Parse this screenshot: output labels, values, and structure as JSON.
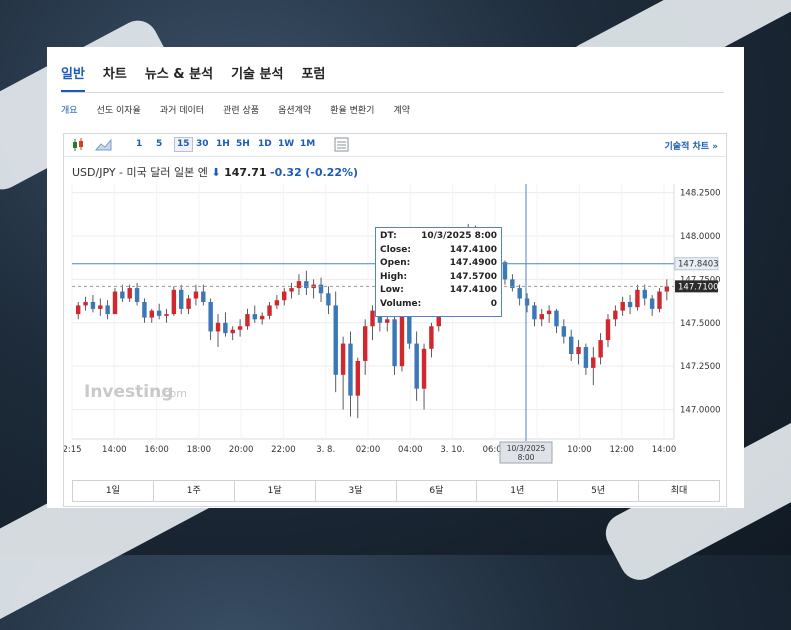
{
  "main_tabs": [
    "일반",
    "차트",
    "뉴스 & 분석",
    "기술 분석",
    "포럼"
  ],
  "sub_tabs": [
    "개요",
    "선도 이자율",
    "과거 데이터",
    "관련 상품",
    "옵션계약",
    "환율 변환기",
    "계약"
  ],
  "toolbar": {
    "intervals": [
      "1",
      "5",
      "15",
      "30",
      "1H",
      "5H",
      "1D",
      "1W",
      "1M"
    ],
    "selected_interval": "15",
    "technical_chart_link": "기술적 차트 »"
  },
  "quote": {
    "name": "USD/JPY - 미국 달러 일본 엔",
    "arrow": "⬇",
    "price": "147.71",
    "change": "-0.32",
    "change_pct": "(-0.22%)"
  },
  "watermark": "Investing",
  "watermark_suffix": ".com",
  "tooltip": {
    "rows": [
      {
        "k": "DT:",
        "v": "10/3/2025 8:00"
      },
      {
        "k": "Close:",
        "v": "147.4100"
      },
      {
        "k": "Open:",
        "v": "147.4900"
      },
      {
        "k": "High:",
        "v": "147.5700"
      },
      {
        "k": "Low:",
        "v": "147.4100"
      },
      {
        "k": "Volume:",
        "v": "0"
      }
    ]
  },
  "range_buttons": [
    "1일",
    "1주",
    "1달",
    "3달",
    "6달",
    "1년",
    "5년",
    "최대"
  ],
  "colors": {
    "up": "#d0282e",
    "down": "#3b78b8",
    "accent": "#1a5bb8"
  },
  "chart_data": {
    "type": "candlestick",
    "y_ticks": [
      "148.2500",
      "148.0000",
      "147.7500",
      "147.5000",
      "147.2500",
      "147.0000"
    ],
    "ylim": [
      146.83,
      148.3
    ],
    "x_ticks": [
      "2:15",
      "14:00",
      "16:00",
      "18:00",
      "20:00",
      "22:00",
      "3. 8.",
      "02:00",
      "04:00",
      "3. 10.",
      "06:00",
      "08:00",
      "10:00",
      "12:00",
      "14:00"
    ],
    "crosshair_x_label": "10/3/2025\n8:00",
    "crosshair_y_label": "147.8403",
    "last_price_label": "147.7100",
    "candles_ohlc": [
      [
        147.55,
        147.62,
        147.52,
        147.6
      ],
      [
        147.6,
        147.65,
        147.57,
        147.62
      ],
      [
        147.62,
        147.66,
        147.56,
        147.58
      ],
      [
        147.58,
        147.64,
        147.54,
        147.6
      ],
      [
        147.6,
        147.63,
        147.52,
        147.55
      ],
      [
        147.55,
        147.7,
        147.55,
        147.68
      ],
      [
        147.68,
        147.72,
        147.62,
        147.64
      ],
      [
        147.64,
        147.72,
        147.62,
        147.7
      ],
      [
        147.7,
        147.73,
        147.6,
        147.62
      ],
      [
        147.62,
        147.64,
        147.5,
        147.53
      ],
      [
        147.53,
        147.58,
        147.5,
        147.57
      ],
      [
        147.57,
        147.61,
        147.52,
        147.54
      ],
      [
        147.54,
        147.58,
        147.5,
        147.55
      ],
      [
        147.55,
        147.71,
        147.54,
        147.69
      ],
      [
        147.69,
        147.72,
        147.55,
        147.58
      ],
      [
        147.58,
        147.66,
        147.55,
        147.64
      ],
      [
        147.64,
        147.72,
        147.6,
        147.68
      ],
      [
        147.68,
        147.72,
        147.6,
        147.62
      ],
      [
        147.62,
        147.64,
        147.4,
        147.45
      ],
      [
        147.45,
        147.55,
        147.36,
        147.5
      ],
      [
        147.5,
        147.56,
        147.42,
        147.44
      ],
      [
        147.44,
        147.48,
        147.4,
        147.46
      ],
      [
        147.46,
        147.52,
        147.42,
        147.48
      ],
      [
        147.48,
        147.58,
        147.46,
        147.55
      ],
      [
        147.55,
        147.6,
        147.5,
        147.52
      ],
      [
        147.52,
        147.56,
        147.49,
        147.54
      ],
      [
        147.54,
        147.62,
        147.52,
        147.6
      ],
      [
        147.6,
        147.66,
        147.58,
        147.63
      ],
      [
        147.63,
        147.7,
        147.6,
        147.68
      ],
      [
        147.68,
        147.73,
        147.64,
        147.7
      ],
      [
        147.7,
        147.78,
        147.66,
        147.74
      ],
      [
        147.74,
        147.8,
        147.66,
        147.7
      ],
      [
        147.7,
        147.75,
        147.64,
        147.72
      ],
      [
        147.72,
        147.76,
        147.62,
        147.67
      ],
      [
        147.67,
        147.71,
        147.55,
        147.6
      ],
      [
        147.6,
        147.68,
        147.1,
        147.2
      ],
      [
        147.2,
        147.42,
        147.0,
        147.38
      ],
      [
        147.38,
        147.45,
        146.96,
        147.08
      ],
      [
        147.08,
        147.3,
        146.95,
        147.28
      ],
      [
        147.28,
        147.52,
        147.2,
        147.48
      ],
      [
        147.48,
        147.6,
        147.4,
        147.57
      ],
      [
        147.57,
        147.65,
        147.45,
        147.5
      ],
      [
        147.5,
        147.7,
        147.45,
        147.52
      ],
      [
        147.52,
        147.55,
        147.2,
        147.25
      ],
      [
        147.25,
        147.58,
        147.22,
        147.55
      ],
      [
        147.55,
        147.6,
        147.35,
        147.38
      ],
      [
        147.38,
        147.45,
        147.05,
        147.12
      ],
      [
        147.12,
        147.38,
        147.0,
        147.35
      ],
      [
        147.35,
        147.5,
        147.3,
        147.48
      ],
      [
        147.48,
        147.62,
        147.45,
        147.6
      ],
      [
        147.6,
        147.7,
        147.55,
        147.65
      ],
      [
        147.65,
        147.8,
        147.62,
        147.76
      ],
      [
        147.76,
        148.05,
        147.7,
        148.02
      ],
      [
        148.02,
        148.07,
        147.98,
        148.03
      ],
      [
        148.03,
        148.06,
        147.96,
        147.98
      ],
      [
        147.98,
        148.0,
        147.9,
        147.94
      ],
      [
        147.94,
        147.97,
        147.86,
        147.9
      ],
      [
        147.9,
        147.92,
        147.82,
        147.85
      ],
      [
        147.85,
        147.86,
        147.72,
        147.75
      ],
      [
        147.75,
        147.78,
        147.68,
        147.7
      ],
      [
        147.7,
        147.72,
        147.6,
        147.64
      ],
      [
        147.64,
        147.67,
        147.56,
        147.6
      ],
      [
        147.6,
        147.62,
        147.48,
        147.52
      ],
      [
        147.52,
        147.58,
        147.48,
        147.55
      ],
      [
        147.55,
        147.6,
        147.5,
        147.57
      ],
      [
        147.57,
        147.58,
        147.44,
        147.48
      ],
      [
        147.48,
        147.52,
        147.38,
        147.42
      ],
      [
        147.42,
        147.46,
        147.28,
        147.32
      ],
      [
        147.32,
        147.4,
        147.26,
        147.36
      ],
      [
        147.36,
        147.38,
        147.2,
        147.24
      ],
      [
        147.24,
        147.36,
        147.14,
        147.3
      ],
      [
        147.3,
        147.44,
        147.26,
        147.4
      ],
      [
        147.4,
        147.55,
        147.36,
        147.52
      ],
      [
        147.52,
        147.6,
        147.48,
        147.57
      ],
      [
        147.57,
        147.65,
        147.54,
        147.62
      ],
      [
        147.62,
        147.66,
        147.55,
        147.59
      ],
      [
        147.59,
        147.72,
        147.57,
        147.69
      ],
      [
        147.69,
        147.72,
        147.6,
        147.64
      ],
      [
        147.64,
        147.66,
        147.54,
        147.58
      ],
      [
        147.58,
        147.7,
        147.56,
        147.68
      ],
      [
        147.68,
        147.75,
        147.63,
        147.71
      ]
    ]
  }
}
